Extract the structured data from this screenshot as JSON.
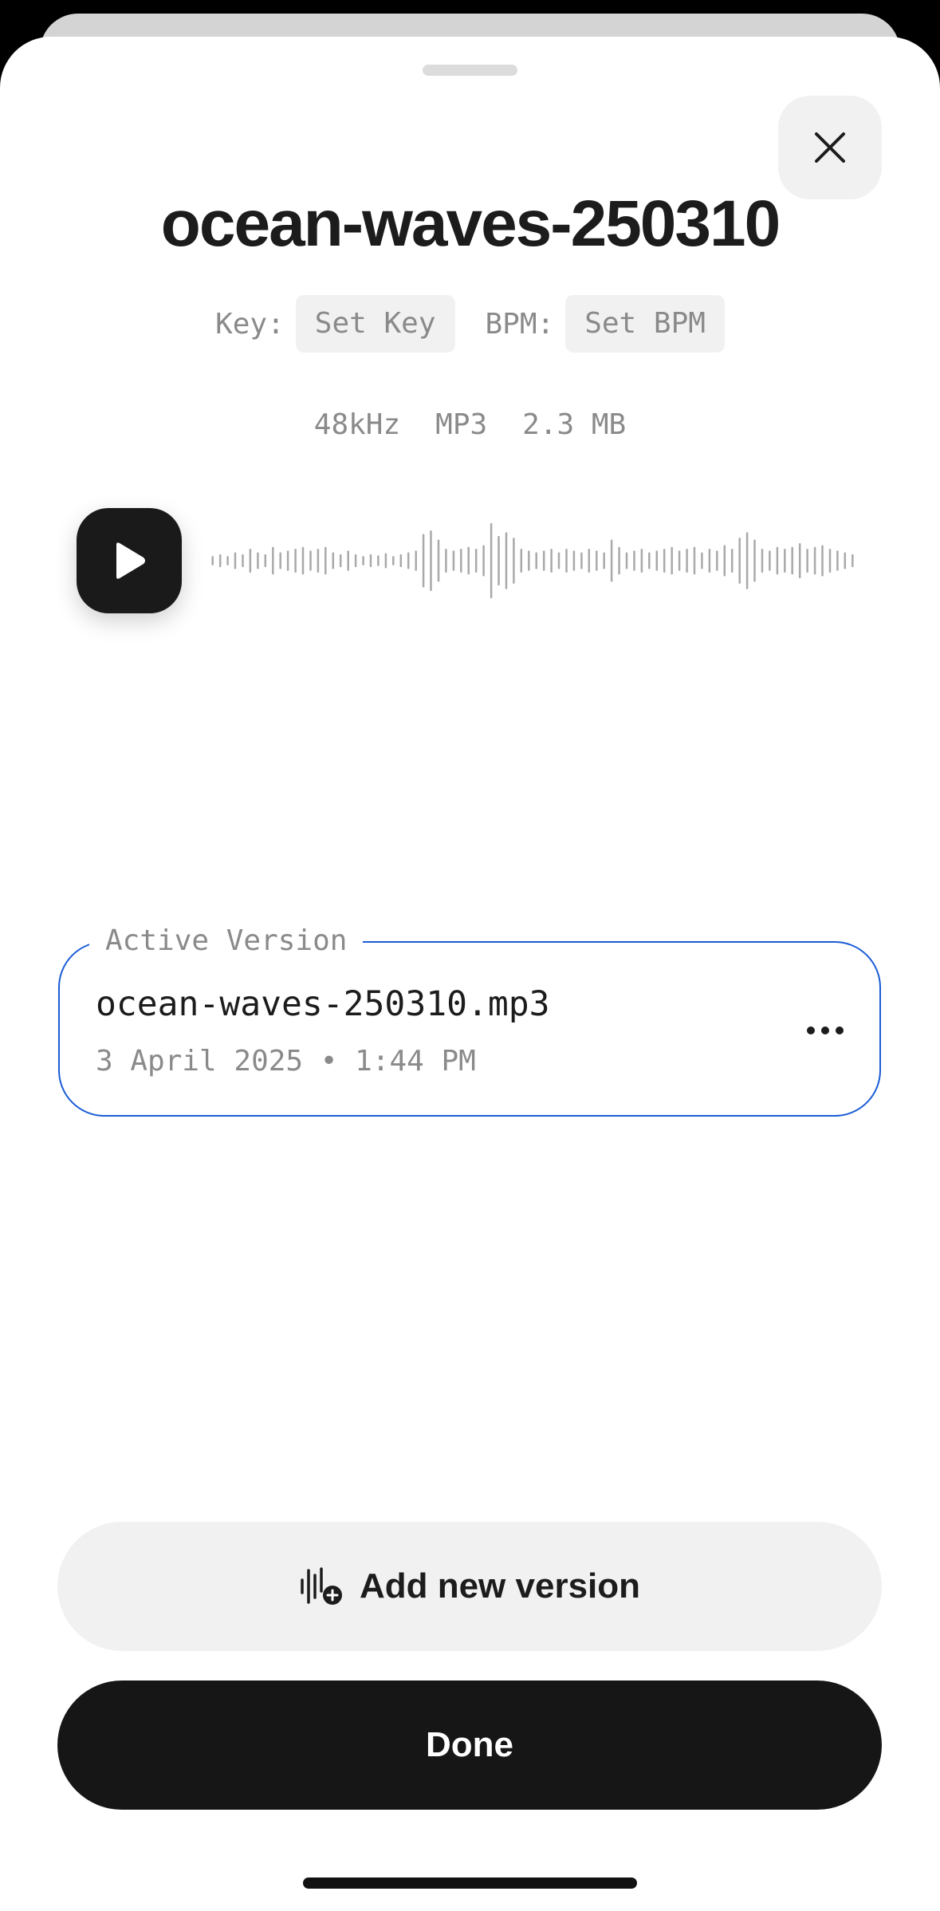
{
  "track": {
    "title": "ocean-waves-250310",
    "key_label": "Key:",
    "key_value": "Set Key",
    "bpm_label": "BPM:",
    "bpm_value": "Set BPM",
    "sample_rate": "48kHz",
    "format": "MP3",
    "size": "2.3 MB"
  },
  "player": {
    "play_icon": "play-icon",
    "waveform_levels": [
      0.1,
      0.15,
      0.1,
      0.2,
      0.15,
      0.3,
      0.2,
      0.15,
      0.35,
      0.2,
      0.25,
      0.3,
      0.35,
      0.25,
      0.3,
      0.35,
      0.2,
      0.15,
      0.25,
      0.15,
      0.1,
      0.15,
      0.12,
      0.18,
      0.1,
      0.15,
      0.2,
      0.25,
      0.7,
      0.8,
      0.55,
      0.3,
      0.25,
      0.3,
      0.35,
      0.3,
      0.4,
      1.0,
      0.65,
      0.75,
      0.6,
      0.3,
      0.25,
      0.2,
      0.25,
      0.3,
      0.2,
      0.3,
      0.25,
      0.2,
      0.3,
      0.25,
      0.2,
      0.55,
      0.35,
      0.2,
      0.25,
      0.3,
      0.2,
      0.25,
      0.3,
      0.35,
      0.25,
      0.3,
      0.35,
      0.2,
      0.3,
      0.25,
      0.4,
      0.3,
      0.6,
      0.75,
      0.55,
      0.3,
      0.25,
      0.35,
      0.3,
      0.35,
      0.45,
      0.3,
      0.35,
      0.4,
      0.3,
      0.25,
      0.2,
      0.15
    ]
  },
  "active_version": {
    "legend": "Active Version",
    "filename": "ocean-waves-250310.mp3",
    "date": "3 April 2025 • 1:44 PM",
    "more_icon": "more-horizontal-icon"
  },
  "actions": {
    "add_version_label": "Add new version",
    "add_version_icon": "waveform-plus-icon",
    "done_label": "Done"
  },
  "colors": {
    "accent_border": "#1a5cd6",
    "primary_button": "#161616",
    "secondary_button": "#f1f1f1",
    "waveform": "#a9a9a9"
  }
}
